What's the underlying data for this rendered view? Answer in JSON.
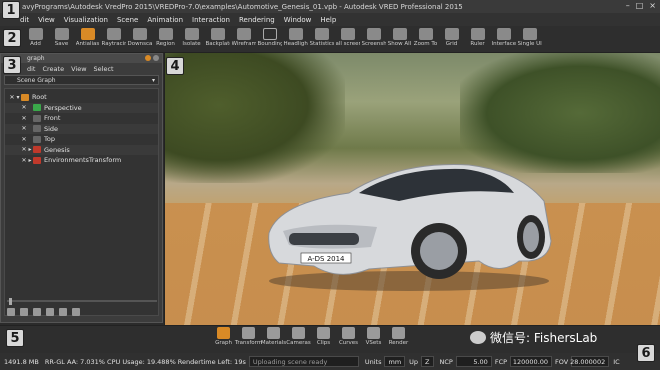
{
  "window": {
    "title": "avyPrograms\\Autodesk VredPro 2015\\VREDPro-7.0\\examples\\Automotive_Genesis_01.vpb - Autodesk VRED Professional 2015",
    "controls": [
      "–",
      "□",
      "×"
    ]
  },
  "menu": [
    "dit",
    "View",
    "Visualization",
    "Scene",
    "Animation",
    "Interaction",
    "Rendering",
    "Window",
    "Help"
  ],
  "toolbar": [
    {
      "label": "Add",
      "icon": "add-icon"
    },
    {
      "label": "Save",
      "icon": "save-icon"
    },
    {
      "label": "Antialias",
      "icon": "antialias-icon",
      "active": true
    },
    {
      "label": "Raytracing",
      "icon": "raytracing-icon"
    },
    {
      "label": "Downscale",
      "icon": "downscale-icon"
    },
    {
      "label": "Region",
      "icon": "region-icon"
    },
    {
      "label": "Isolate",
      "icon": "isolate-icon"
    },
    {
      "label": "Backplate",
      "icon": "backplate-icon"
    },
    {
      "label": "Wireframe",
      "icon": "wireframe-icon"
    },
    {
      "label": "Boundings",
      "icon": "boundings-icon",
      "box": true
    },
    {
      "label": "Headlight",
      "icon": "headlight-icon"
    },
    {
      "label": "Statistics",
      "icon": "statistics-icon"
    },
    {
      "label": "all screenshot",
      "icon": "screenshot-icon"
    },
    {
      "label": "Screenshot",
      "icon": "screenshot2-icon"
    },
    {
      "label": "Show All",
      "icon": "show-all-icon"
    },
    {
      "label": "Zoom To",
      "icon": "zoom-to-icon"
    },
    {
      "label": "Grid",
      "icon": "grid-icon"
    },
    {
      "label": "Ruler",
      "icon": "ruler-icon"
    },
    {
      "label": "Interface",
      "icon": "interface-icon"
    },
    {
      "label": "Single UI",
      "icon": "single-ui-icon"
    }
  ],
  "scenegraph": {
    "title": "graph",
    "menu": [
      "dit",
      "Create",
      "View",
      "Select"
    ],
    "dropdown": "Scene Graph",
    "nodes": [
      {
        "label": "Root",
        "level": 0,
        "color": "#d98a26",
        "expander": "▾"
      },
      {
        "label": "Perspective",
        "level": 1,
        "color": "#3aa84a",
        "expander": ""
      },
      {
        "label": "Front",
        "level": 1,
        "color": "#666666",
        "expander": ""
      },
      {
        "label": "Side",
        "level": 1,
        "color": "#666666",
        "expander": ""
      },
      {
        "label": "Top",
        "level": 1,
        "color": "#666666",
        "expander": ""
      },
      {
        "label": "Genesis",
        "level": 1,
        "color": "#c0392b",
        "expander": "▸"
      },
      {
        "label": "EnvironmentsTransform",
        "level": 1,
        "color": "#c0392b",
        "expander": "▸"
      }
    ]
  },
  "bottom_toolbar": [
    {
      "label": "Graph",
      "icon": "graph-icon",
      "active": true
    },
    {
      "label": "Transform",
      "icon": "transform-icon"
    },
    {
      "label": "Materials",
      "icon": "materials-icon"
    },
    {
      "label": "Cameras",
      "icon": "cameras-icon"
    },
    {
      "label": "Clips",
      "icon": "clips-icon"
    },
    {
      "label": "Curves",
      "icon": "curves-icon"
    },
    {
      "label": "VSets",
      "icon": "vsets-icon"
    },
    {
      "label": "Render",
      "icon": "render-icon"
    }
  ],
  "watermark": "微信号: FishersLab",
  "car": {
    "plate": "A-DS 2014"
  },
  "status": {
    "memory": "1491.8 MB",
    "info": "RR-GL AA: 7.031% CPU Usage: 19.488% Rendertime Left: 19s",
    "message": "Uploading scene ready",
    "units_label": "Units",
    "units_value": "mm",
    "up_label": "Up",
    "up_value": "Z",
    "ncp_label": "NCP",
    "ncp_value": "5.00",
    "fcp_label": "FCP",
    "fcp_value": "120000.00",
    "fov_label": "FOV",
    "fov_value": "28.000002",
    "icv_label": "IC"
  },
  "badges": [
    "1",
    "2",
    "3",
    "4",
    "5",
    "6"
  ]
}
